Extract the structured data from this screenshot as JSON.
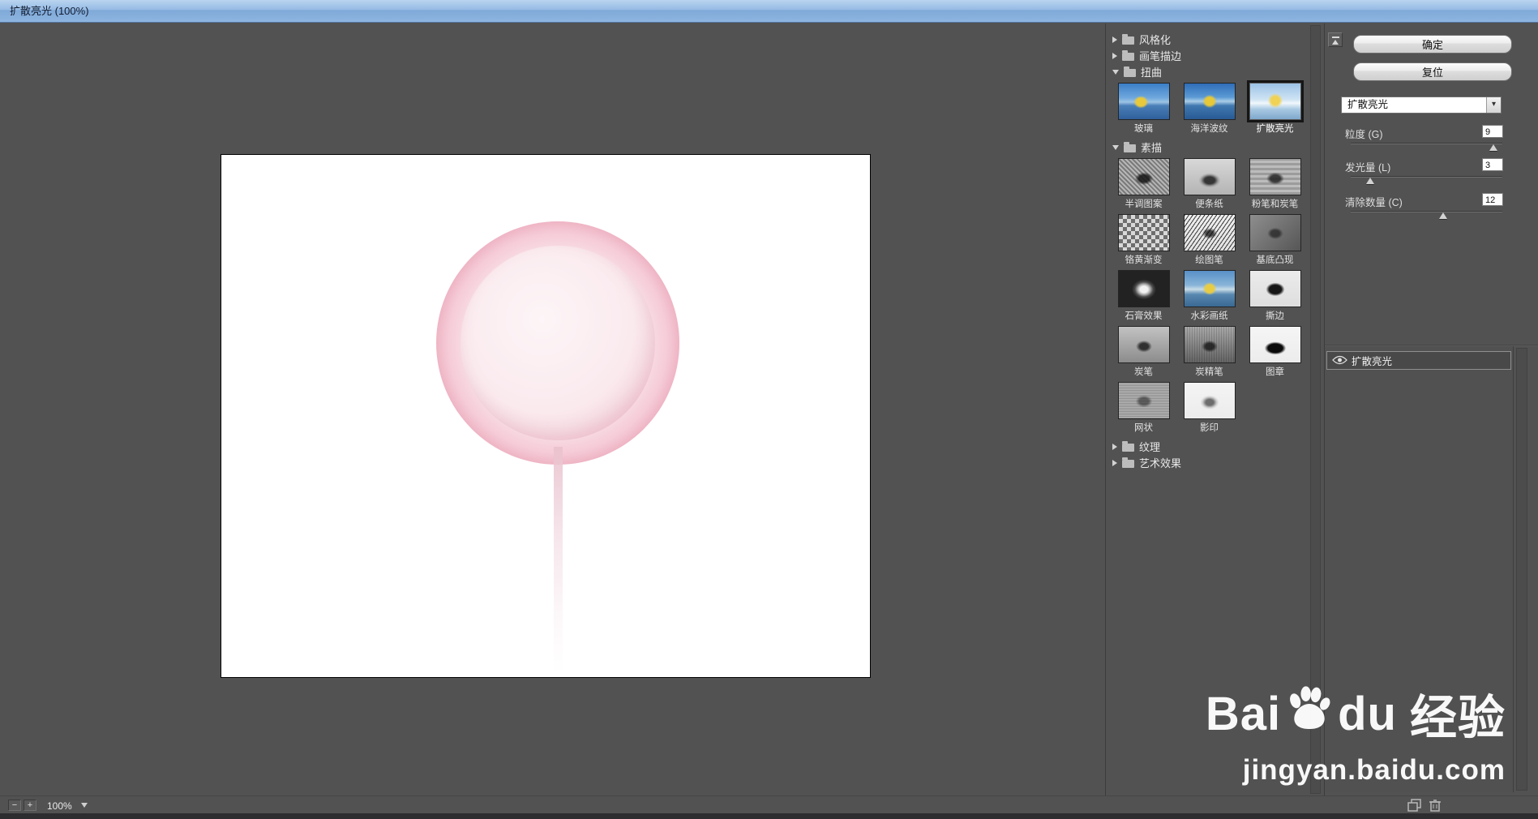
{
  "title_bar": {
    "title": "扩散亮光 (100%)"
  },
  "colors": {
    "titlebar_blue": "#8fb5e0",
    "panel_gray": "#525252",
    "candy_pink": "#e698ad"
  },
  "filter_gallery": {
    "categories": [
      {
        "label": "风格化",
        "expanded": false,
        "thumbs": []
      },
      {
        "label": "画笔描边",
        "expanded": false,
        "thumbs": []
      },
      {
        "label": "扭曲",
        "expanded": true,
        "thumbs": [
          {
            "label": "玻璃",
            "kind": "glass",
            "selected": false
          },
          {
            "label": "海洋波纹",
            "kind": "ocean",
            "selected": false
          },
          {
            "label": "扩散亮光",
            "kind": "glow",
            "selected": true
          }
        ]
      },
      {
        "label": "素描",
        "expanded": true,
        "thumbs": [
          {
            "label": "半调图案",
            "kind": "halftone",
            "selected": false
          },
          {
            "label": "便条纸",
            "kind": "notepaper",
            "selected": false
          },
          {
            "label": "粉笔和炭笔",
            "kind": "chalk",
            "selected": false
          },
          {
            "label": "铬黄渐变",
            "kind": "chrome",
            "selected": false
          },
          {
            "label": "绘图笔",
            "kind": "pen",
            "selected": false
          },
          {
            "label": "基底凸现",
            "kind": "basrelief",
            "selected": false
          },
          {
            "label": "石膏效果",
            "kind": "plaster",
            "selected": false
          },
          {
            "label": "水彩画纸",
            "kind": "watercolor",
            "selected": false
          },
          {
            "label": "撕边",
            "kind": "torn",
            "selected": false
          },
          {
            "label": "炭笔",
            "kind": "charcoal",
            "selected": false
          },
          {
            "label": "炭精笔",
            "kind": "conte",
            "selected": false
          },
          {
            "label": "图章",
            "kind": "stamp",
            "selected": false
          },
          {
            "label": "网状",
            "kind": "reticulation",
            "selected": false
          },
          {
            "label": "影印",
            "kind": "photocopy",
            "selected": false
          }
        ]
      },
      {
        "label": "纹理",
        "expanded": false,
        "thumbs": []
      },
      {
        "label": "艺术效果",
        "expanded": false,
        "thumbs": []
      }
    ]
  },
  "controls": {
    "ok_label": "确定",
    "reset_label": "复位",
    "filter_select": {
      "value": "扩散亮光"
    },
    "sliders": [
      {
        "label": "粒度 (G)",
        "value": "9",
        "percent": 94
      },
      {
        "label": "发光量 (L)",
        "value": "3",
        "percent": 13
      },
      {
        "label": "清除数量 (C)",
        "value": "12",
        "percent": 61
      }
    ],
    "effect_layers": [
      {
        "label": "扩散亮光",
        "visible": true,
        "selected": true
      }
    ]
  },
  "statusbar": {
    "zoom": "100%",
    "zoom_out": "−",
    "zoom_in": "+"
  },
  "icons": {
    "dropdown_arrow": "▾"
  },
  "watermark": {
    "brand_prefix": "Bai",
    "brand_suffix": "du",
    "brand_cn": "经验",
    "url": "jingyan.baidu.com"
  }
}
